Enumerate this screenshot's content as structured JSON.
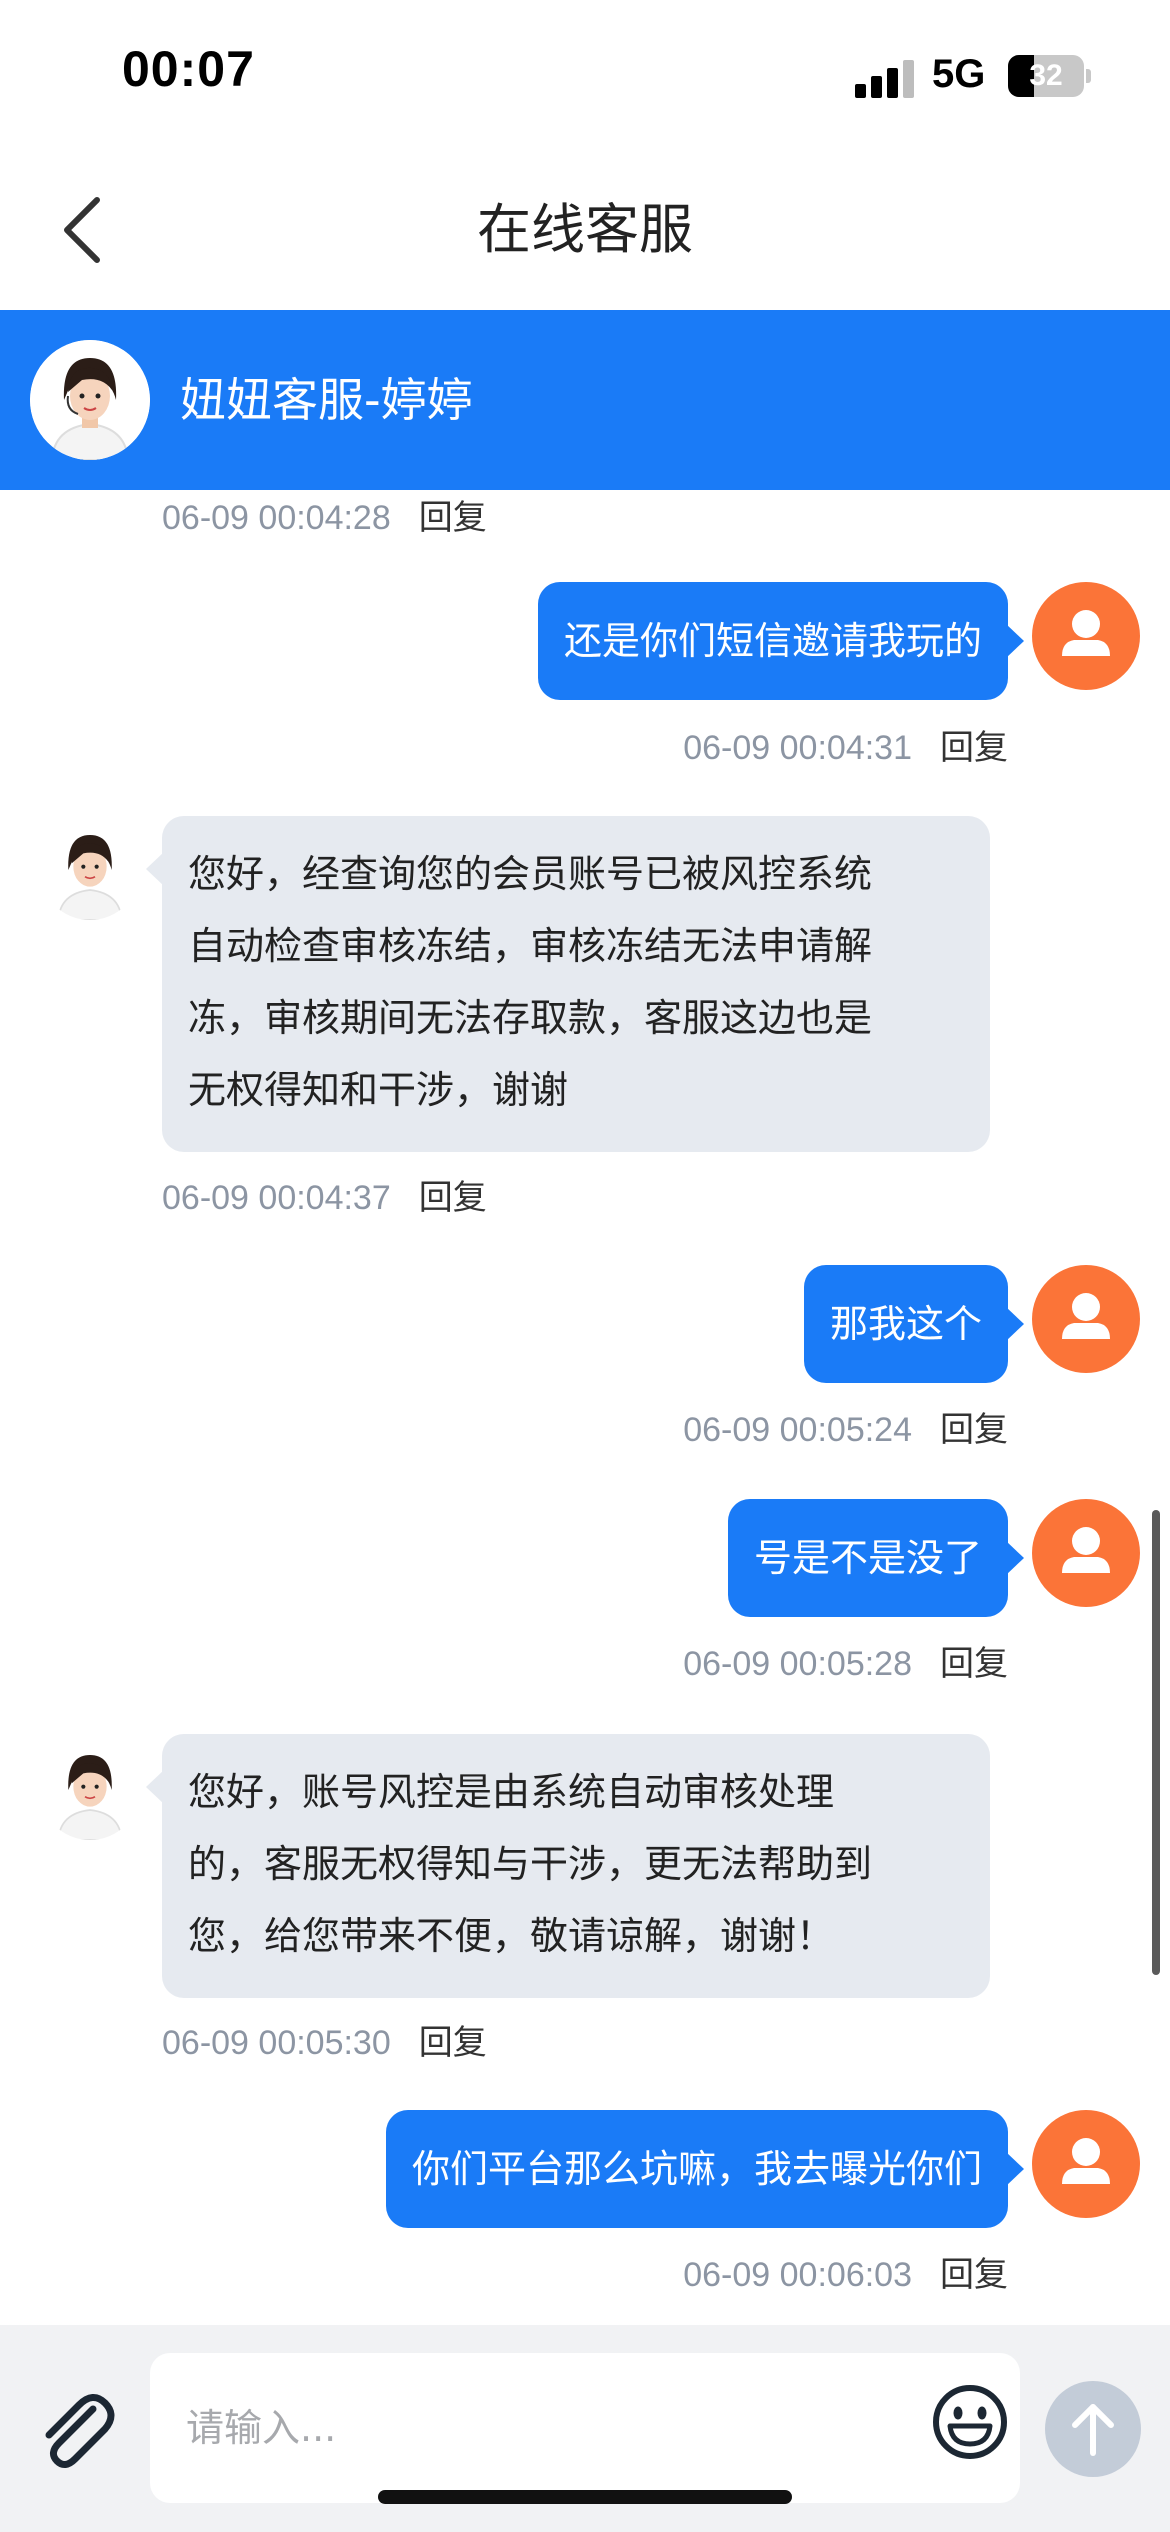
{
  "status_bar": {
    "time": "00:07",
    "network": "5G",
    "battery": "32"
  },
  "header": {
    "title": "在线客服"
  },
  "agent": {
    "name": "妞妞客服-婷婷"
  },
  "reply_label": "回复",
  "messages": [
    {
      "from": "agent",
      "time": "06-09 00:04:28"
    },
    {
      "from": "user",
      "text": "还是你们短信邀请我玩的",
      "time": "06-09 00:04:31"
    },
    {
      "from": "agent",
      "lines": [
        "您好，经查询您的会员账号已被风控系统",
        "自动检查审核冻结，审核冻结无法申请解",
        "冻，审核期间无法存取款，客服这边也是",
        "无权得知和干涉，谢谢"
      ],
      "time": "06-09 00:04:37"
    },
    {
      "from": "user",
      "text": "那我这个",
      "time": "06-09 00:05:24"
    },
    {
      "from": "user",
      "text": "号是不是没了",
      "time": "06-09 00:05:28"
    },
    {
      "from": "agent",
      "lines": [
        "您好，账号风控是由系统自动审核处理",
        "的，客服无权得知与干涉，更无法帮助到",
        "您，给您带来不便，敬请谅解，谢谢！"
      ],
      "time": "06-09 00:05:30"
    },
    {
      "from": "user",
      "text": "你们平台那么坑嘛，我去曝光你们",
      "time": "06-09 00:06:03"
    }
  ],
  "input": {
    "placeholder": "请输入..."
  },
  "colors": {
    "primary": "#1a7bf7",
    "user_avatar": "#fb7438",
    "agent_bubble": "#e6eaf0"
  },
  "icons": [
    "back-icon",
    "attach-icon",
    "emoji-icon",
    "send-arrow-icon",
    "user-icon"
  ]
}
